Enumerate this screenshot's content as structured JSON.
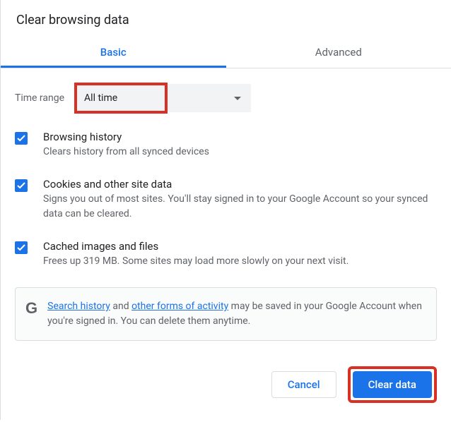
{
  "title": "Clear browsing data",
  "tabs": {
    "basic": "Basic",
    "advanced": "Advanced"
  },
  "time": {
    "label": "Time range",
    "value": "All time"
  },
  "opts": {
    "history": {
      "title": "Browsing history",
      "desc": "Clears history from all synced devices"
    },
    "cookies": {
      "title": "Cookies and other site data",
      "desc": "Signs you out of most sites. You'll stay signed in to your Google Account so your synced data can be cleared."
    },
    "cache": {
      "title": "Cached images and files",
      "desc": "Frees up 319 MB. Some sites may load more slowly on your next visit."
    }
  },
  "info": {
    "link1": "Search history",
    "mid1": " and ",
    "link2": "other forms of activity",
    "rest": " may be saved in your Google Account when you're signed in. You can delete them anytime."
  },
  "buttons": {
    "cancel": "Cancel",
    "clear": "Clear data"
  }
}
